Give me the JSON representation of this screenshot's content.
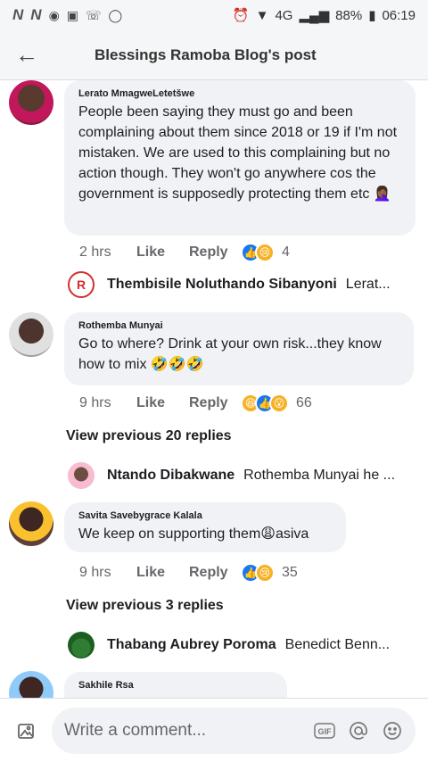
{
  "status_bar": {
    "left_icons": [
      "N",
      "N"
    ],
    "network": "4G",
    "battery": "88%",
    "time": "06:19"
  },
  "header": {
    "title": "Blessings Ramoba Blog's post"
  },
  "comments": [
    {
      "author": "Lerato MmagweLetetšwe",
      "text": "People been saying they must go and been complaining about them since 2018 or 19 if I'm not mistaken. We are used to this complaining but no action though. They won't go anywhere cos the government is supposedly protecting them etc 🤦🏾‍♀️",
      "time": "2 hrs",
      "like": "Like",
      "reply": "Reply",
      "reaction_count": "4"
    },
    {
      "author": "Rothemba Munyai",
      "text": "Go to where? Drink at your own risk...they know how to mix 🤣🤣🤣",
      "time": "9 hrs",
      "like": "Like",
      "reply": "Reply",
      "reaction_count": "66"
    },
    {
      "author": "Savita Savebygrace Kalala",
      "text": "We keep on supporting them😩asiva",
      "time": "9 hrs",
      "like": "Like",
      "reply": "Reply",
      "reaction_count": "35"
    },
    {
      "author": "Sakhile Rsa"
    }
  ],
  "replies": [
    {
      "name": "Thembisile Noluthando Sibanyoni",
      "preview": "Lerat..."
    },
    {
      "name": "Ntando Dibakwane",
      "preview": "Rothemba Munyai he ..."
    },
    {
      "name": "Thabang Aubrey Poroma",
      "preview": "Benedict Benn..."
    }
  ],
  "view_previous": [
    "View previous 20 replies",
    "View previous 3 replies"
  ],
  "composer": {
    "placeholder": "Write a comment..."
  }
}
